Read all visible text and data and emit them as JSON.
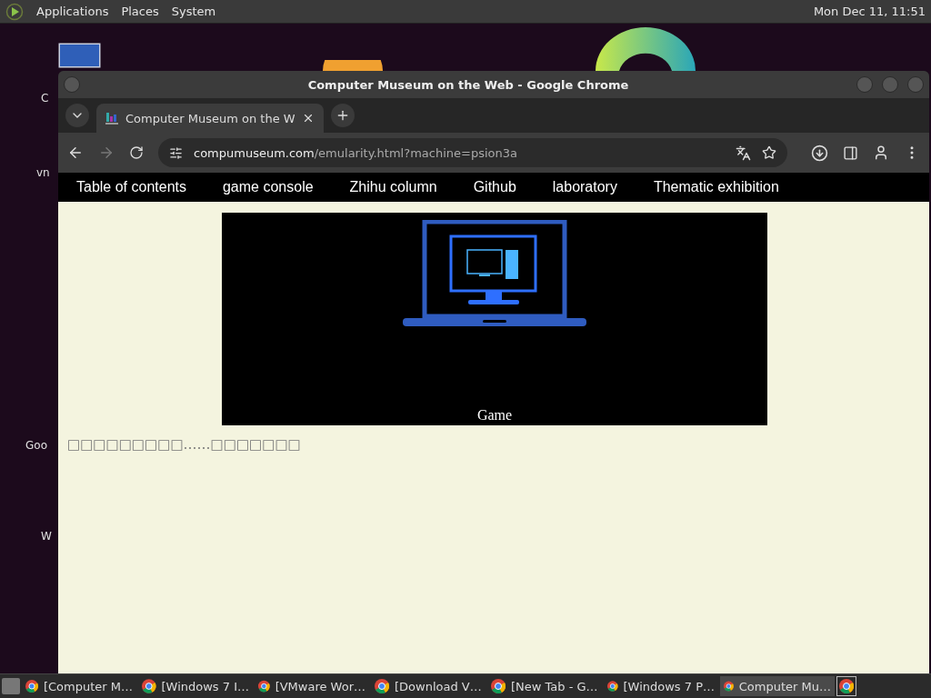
{
  "top_panel": {
    "menus": [
      "Applications",
      "Places",
      "System"
    ],
    "clock": "Mon Dec 11, 11:51"
  },
  "desktop_icons": [
    {
      "label": "C"
    },
    {
      "label": "vn"
    },
    {
      "label": "Goo"
    },
    {
      "label": "W"
    }
  ],
  "window": {
    "title": "Computer Museum on the Web - Google Chrome"
  },
  "tabs": [
    {
      "label": "Computer Museum on the W",
      "selected": true
    }
  ],
  "address_bar": {
    "domain": "compumuseum.com",
    "path": "/emularity.html?machine=psion3a"
  },
  "site_nav": [
    "Table of contents",
    "game console",
    "Zhihu column",
    "Github",
    "laboratory",
    "Thematic exhibition"
  ],
  "banner": {
    "caption": "Game"
  },
  "content_text": "□□□□□□□□□……□□□□□□□",
  "taskbar": [
    {
      "label": "[Computer M…",
      "selected": false
    },
    {
      "label": "[Windows 7 I…",
      "selected": false
    },
    {
      "label": "[VMware Wor…",
      "selected": false
    },
    {
      "label": "[Download V…",
      "selected": false
    },
    {
      "label": "[New Tab - G…",
      "selected": false
    },
    {
      "label": "[Windows 7 P…",
      "selected": false
    },
    {
      "label": "Computer Mu…",
      "selected": true
    }
  ]
}
